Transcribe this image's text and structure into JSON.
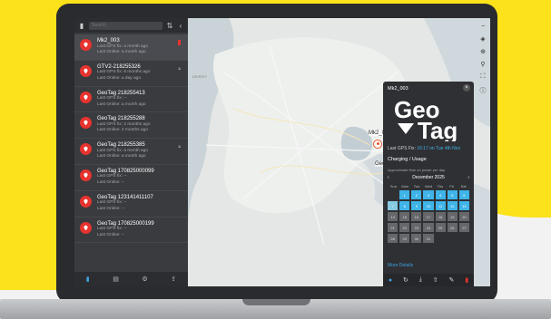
{
  "sidebar": {
    "search_placeholder": "Search",
    "devices": [
      {
        "name": "Mk2_003",
        "gps": "Last GPS fix: a month ago",
        "online": "Last Online: a month ago"
      },
      {
        "name": "GTV2-218255326",
        "gps": "Last GPS fix: 6 months ago",
        "online": "Last Online: a day ago"
      },
      {
        "name": "GeoTag 218255413",
        "gps": "Last GPS fix: --",
        "online": "Last Online: a month ago"
      },
      {
        "name": "GeoTag 218255288",
        "gps": "Last GPS fix: 2 months ago",
        "online": "Last Online: 2 months ago"
      },
      {
        "name": "GeoTag 218255385",
        "gps": "Last GPS fix: a month ago",
        "online": "Last Online: a month ago"
      },
      {
        "name": "GeoTag 170825000099",
        "gps": "Last GPS fix: --",
        "online": "Last Online: --"
      },
      {
        "name": "GeoTag 123141411107",
        "gps": "Last GPS fix: --",
        "online": "Last Online: --"
      },
      {
        "name": "GeoTag 170825000199",
        "gps": "Last GPS fix: --",
        "online": "Last Online: --"
      }
    ]
  },
  "map": {
    "markers": [
      {
        "label": "Mk2_003"
      },
      {
        "label": "GeoTag 218255413"
      }
    ],
    "places": {
      "belfast": "BELFAST",
      "derry": "DERRY"
    }
  },
  "panel": {
    "title": "Mk2_003",
    "logo_line1": "Geo",
    "logo_line2": "Tag",
    "gps_prefix": "Last GPS Fix:",
    "gps_time": "16:17",
    "gps_on": "on",
    "gps_date": "Tue 4th Nov",
    "charging_label": "Charging / Usage",
    "approx_label": "Approximate time on power per day",
    "month": "December 2025",
    "dows": [
      "Sun",
      "Mon",
      "Tue",
      "Wed",
      "Thu",
      "Fri",
      "Sat"
    ],
    "days": [
      "",
      "1",
      "2",
      "3",
      "4",
      "5",
      "6",
      "7",
      "8",
      "9",
      "10",
      "11",
      "12",
      "13",
      "14",
      "15",
      "16",
      "17",
      "18",
      "19",
      "20",
      "21",
      "22",
      "23",
      "24",
      "25",
      "26",
      "27",
      "28",
      "29",
      "30",
      "31",
      "",
      "",
      ""
    ],
    "more_details": "More Details"
  },
  "colors": {
    "accent_blue": "#3fb4e8",
    "pin_red": "#e7332f",
    "brand_yellow": "#fbe21a"
  }
}
